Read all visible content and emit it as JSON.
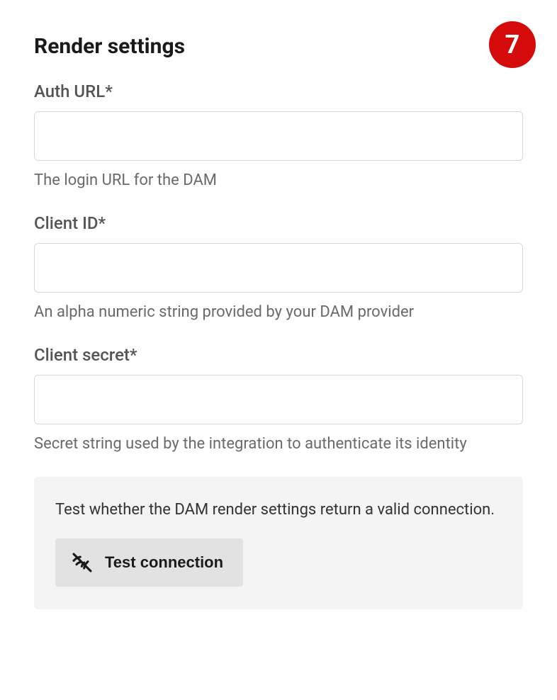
{
  "section": {
    "title": "Render settings",
    "step": "7"
  },
  "fields": {
    "authUrl": {
      "label": "Auth URL*",
      "value": "",
      "help": "The login URL for the DAM"
    },
    "clientId": {
      "label": "Client ID*",
      "value": "",
      "help": "An alpha numeric string provided by your DAM provider"
    },
    "clientSecret": {
      "label": "Client secret*",
      "value": "",
      "help": "Secret string used by the integration to authenticate its identity"
    }
  },
  "testPanel": {
    "help": "Test whether the DAM render settings return a valid connection.",
    "buttonLabel": "Test connection"
  }
}
